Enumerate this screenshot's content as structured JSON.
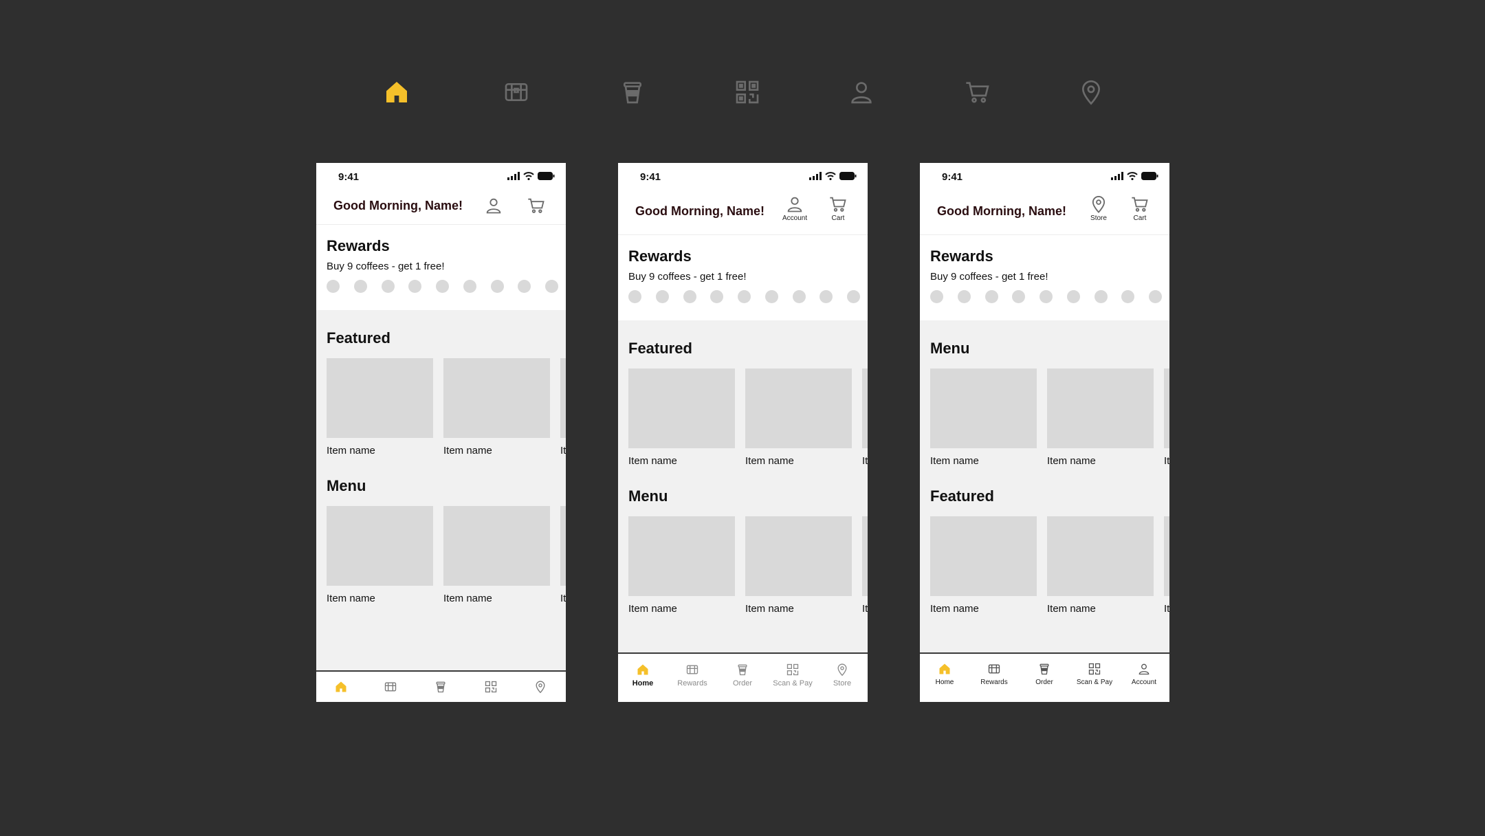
{
  "colors": {
    "accent": "#f5c02a",
    "icon_gray": "#6b6b6b",
    "background": "#2f2f2f"
  },
  "icon_legend": [
    "home-icon",
    "rewards-chest-icon",
    "coffee-cup-icon",
    "qr-code-icon",
    "account-icon",
    "cart-icon",
    "store-location-icon"
  ],
  "status": {
    "time": "9:41"
  },
  "greeting": "Good Morning, Name!",
  "rewards": {
    "title": "Rewards",
    "subtitle": "Buy 9 coffees - get 1 free!",
    "stamps_total": 9,
    "stamps_filled": 0
  },
  "phone1": {
    "header_buttons": [
      "account-icon",
      "cart-icon"
    ],
    "sections": [
      {
        "title": "Featured",
        "items": [
          "Item name",
          "Item name",
          "It"
        ]
      },
      {
        "title": "Menu",
        "items": [
          "Item name",
          "Item name",
          "It"
        ]
      }
    ],
    "tabs": [
      {
        "icon": "home-icon",
        "active": true
      },
      {
        "icon": "rewards-chest-icon",
        "active": false
      },
      {
        "icon": "coffee-cup-icon",
        "active": false
      },
      {
        "icon": "qr-code-icon",
        "active": false
      },
      {
        "icon": "store-location-icon",
        "active": false
      }
    ]
  },
  "phone2": {
    "header_buttons": [
      {
        "icon": "account-icon",
        "label": "Account"
      },
      {
        "icon": "cart-icon",
        "label": "Cart"
      }
    ],
    "sections": [
      {
        "title": "Featured",
        "items": [
          "Item name",
          "Item name",
          "It"
        ]
      },
      {
        "title": "Menu",
        "items": [
          "Item name",
          "Item name",
          "It"
        ]
      }
    ],
    "tabs": [
      {
        "icon": "home-icon",
        "label": "Home",
        "active": true
      },
      {
        "icon": "rewards-chest-icon",
        "label": "Rewards",
        "active": false
      },
      {
        "icon": "coffee-cup-icon",
        "label": "Order",
        "active": false
      },
      {
        "icon": "qr-code-icon",
        "label": "Scan & Pay",
        "active": false
      },
      {
        "icon": "store-location-icon",
        "label": "Store",
        "active": false
      }
    ]
  },
  "phone3": {
    "header_buttons": [
      {
        "icon": "store-location-icon",
        "label": "Store"
      },
      {
        "icon": "cart-icon",
        "label": "Cart"
      }
    ],
    "sections": [
      {
        "title": "Menu",
        "items": [
          "Item name",
          "Item name",
          "It"
        ]
      },
      {
        "title": "Featured",
        "items": [
          "Item name",
          "Item name",
          "It"
        ]
      }
    ],
    "tabs": [
      {
        "icon": "home-icon",
        "label": "Home",
        "active": true
      },
      {
        "icon": "rewards-chest-icon",
        "label": "Rewards",
        "active": false
      },
      {
        "icon": "coffee-cup-icon",
        "label": "Order",
        "active": false
      },
      {
        "icon": "qr-code-icon",
        "label": "Scan & Pay",
        "active": false
      },
      {
        "icon": "account-icon",
        "label": "Account",
        "active": false
      }
    ]
  }
}
